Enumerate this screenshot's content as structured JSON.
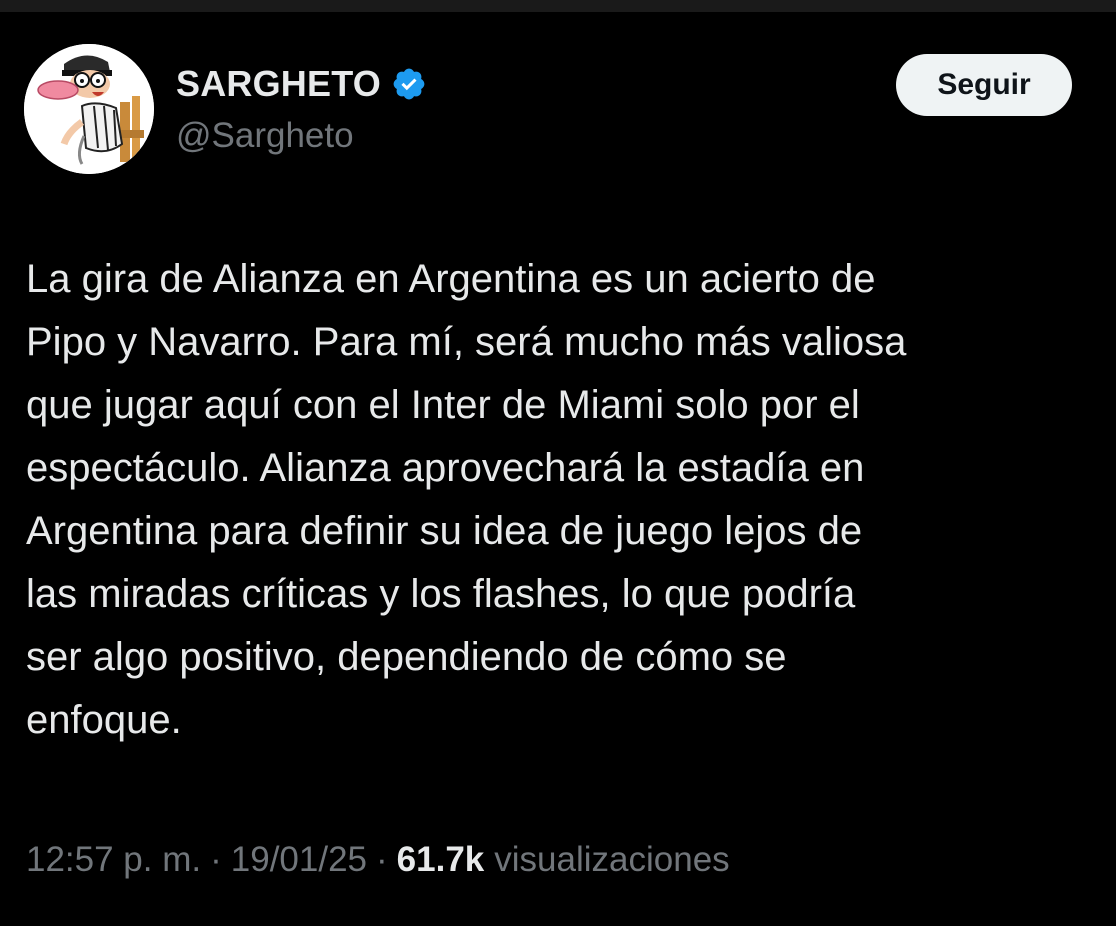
{
  "user": {
    "display_name": "SARGHETO",
    "handle": "@Sargheto",
    "verified": true,
    "verified_color": "#1d9bf0"
  },
  "follow_button": {
    "label": "Seguir"
  },
  "tweet": {
    "text": "La gira de Alianza en Argentina es un acierto de\nPipo y Navarro. Para mí, será mucho más valiosa\nque jugar aquí con el Inter de Miami solo por el\nespectáculo. Alianza aprovechará la estadía en\nArgentina para definir su idea de juego lejos de\nlas miradas críticas y los flashes, lo que podría\nser algo positivo, dependiendo de cómo se\nenfoque."
  },
  "meta": {
    "time": "12:57 p. m.",
    "separator": "·",
    "date": "19/01/25",
    "views_count": "61.7k",
    "views_label": "visualizaciones"
  },
  "colors": {
    "background": "#000000",
    "text_primary": "#e7e9ea",
    "text_secondary": "#71767b",
    "button_bg": "#eff3f4"
  }
}
